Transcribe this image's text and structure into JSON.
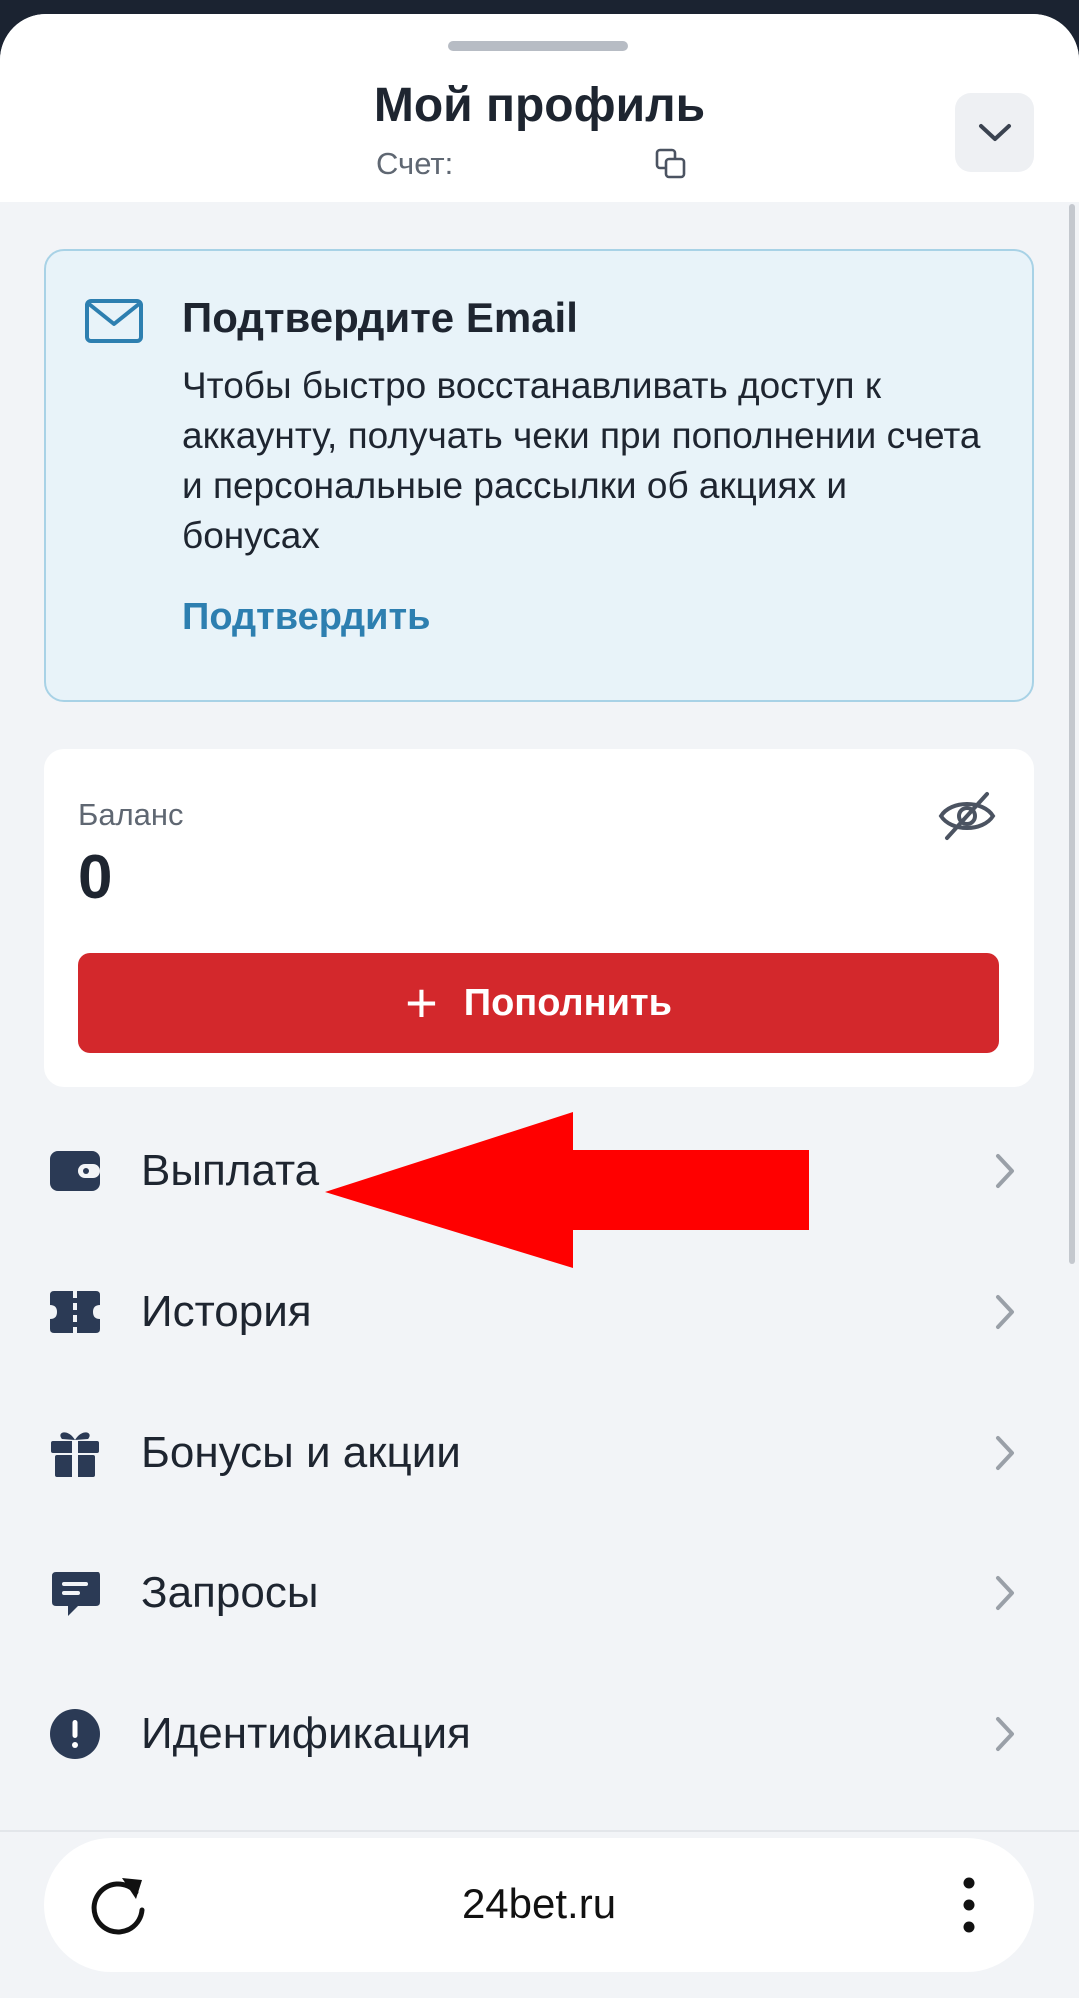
{
  "header": {
    "title": "Мой профиль",
    "account_label": "Счет:"
  },
  "email_card": {
    "title": "Подтвердите Email",
    "text": "Чтобы быстро восстанавливать доступ к аккаунту, получать чеки при пополнении счета и персональные рассылки об акциях и бонусах",
    "link": "Подтвердить"
  },
  "balance": {
    "label": "Баланс",
    "value": "0",
    "topup_plus": "+",
    "topup_label": "Пополнить"
  },
  "menu": {
    "items": [
      {
        "label": "Выплата",
        "icon": "wallet-icon"
      },
      {
        "label": "История",
        "icon": "ticket-icon"
      },
      {
        "label": "Бонусы и акции",
        "icon": "gift-icon"
      },
      {
        "label": "Запросы",
        "icon": "chat-icon"
      },
      {
        "label": "Идентификация",
        "icon": "alert-icon"
      }
    ]
  },
  "browser": {
    "url": "24bet.ru"
  },
  "colors": {
    "accent_red": "#d3282c",
    "link_blue": "#2d7fb0",
    "icon_navy": "#2b3a55",
    "annotation_arrow": "#ff0000"
  }
}
